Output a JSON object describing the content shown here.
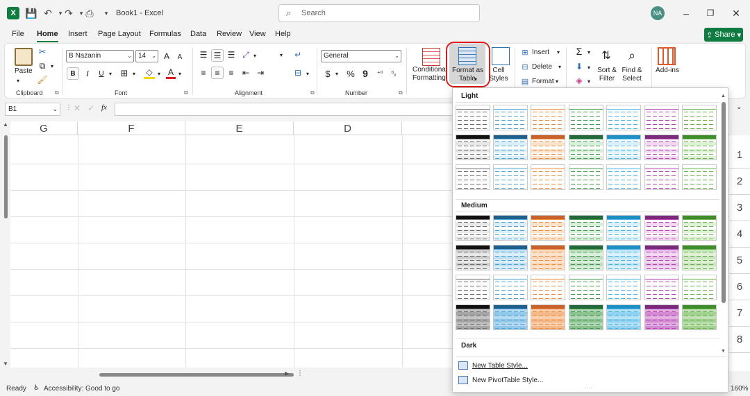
{
  "window": {
    "app_logo": "X",
    "doc_title": "Book1  -  Excel",
    "search_placeholder": "Search",
    "user_initials": "NA",
    "minimize": "–",
    "restore": "❐",
    "close": "✕"
  },
  "menu": {
    "tabs": [
      "File",
      "Home",
      "Insert",
      "Page Layout",
      "Formulas",
      "Data",
      "Review",
      "View",
      "Help"
    ],
    "active_tab": "Home",
    "share_label": "Share"
  },
  "ribbon": {
    "clipboard": {
      "label": "Clipboard",
      "paste": "Paste"
    },
    "font": {
      "label": "Font",
      "font_name": "B Nazanin",
      "font_size": "14",
      "grow": "A",
      "shrink": "A",
      "bold": "B",
      "italic": "I",
      "underline": "U"
    },
    "alignment": {
      "label": "Alignment"
    },
    "number": {
      "label": "Number",
      "format": "General",
      "currency": "$",
      "percent": "%",
      "comma": "9"
    },
    "styles": {
      "conditional": "Conditional\nFormatting",
      "format_as_table": "Format as\nTable",
      "cell_styles": "Cell\nStyles"
    },
    "cells": {
      "insert": "Insert",
      "delete": "Delete",
      "format": "Format"
    },
    "editing": {
      "sum": "Σ",
      "sort_filter": "Sort &\nFilter",
      "find_select": "Find &\nSelect"
    },
    "addins": {
      "label": "Add-ins"
    }
  },
  "formula_bar": {
    "name_box": "B1",
    "fx": "fx"
  },
  "grid": {
    "columns": [
      "G",
      "F",
      "E",
      "D"
    ],
    "rows": [
      "1",
      "2",
      "3",
      "4",
      "5",
      "6",
      "7",
      "8"
    ]
  },
  "status": {
    "ready": "Ready",
    "accessibility": "Accessibility: Good to go",
    "zoom": "160%"
  },
  "gallery": {
    "light_title": "Light",
    "medium_title": "Medium",
    "dark_title": "Dark",
    "new_table_style": "New Table Style...",
    "new_pivot_style": "New PivotTable Style...",
    "palette": [
      "#6b6b6b",
      "#4aa3d9",
      "#ef8b3b",
      "#3f9a4a",
      "#47b5e6",
      "#b63fb5",
      "#66b34a"
    ],
    "palette_light": [
      "#e8e8e8",
      "#dbeef9",
      "#fde2cc",
      "#d8efd9",
      "#daf0fa",
      "#f2d9f1",
      "#dff1d5"
    ],
    "palette_dark": [
      "#111111",
      "#1f5f8b",
      "#c8612a",
      "#22683a",
      "#1e8fc4",
      "#7a2a7a",
      "#3e8c2a"
    ]
  }
}
